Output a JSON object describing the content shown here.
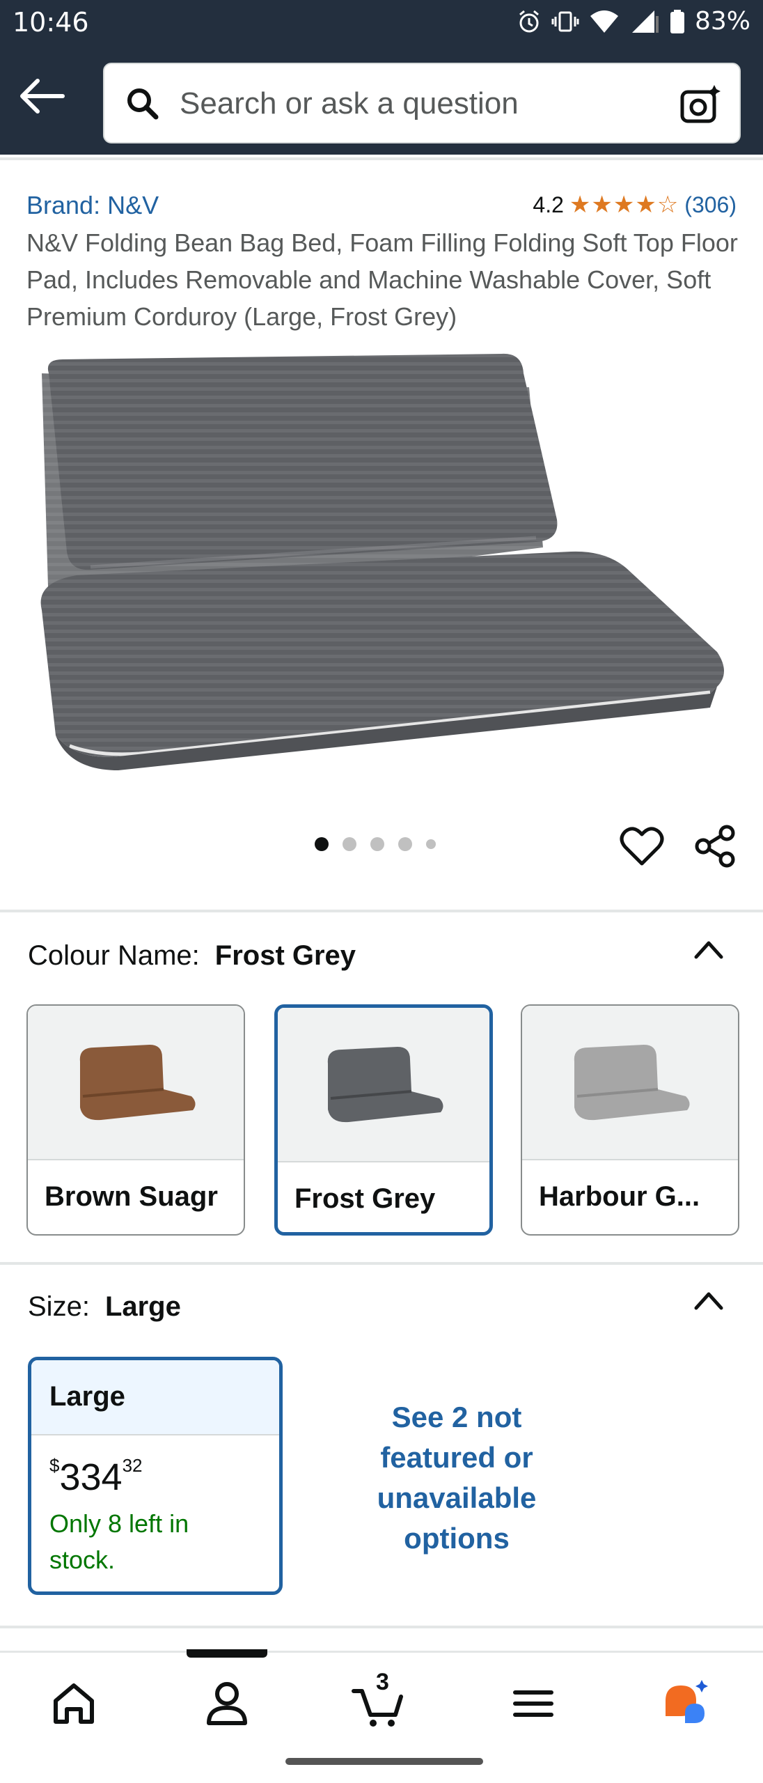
{
  "status_bar": {
    "time": "10:46",
    "battery": "83%",
    "icons": [
      "alarm-icon",
      "vibrate-icon",
      "wifi-icon",
      "signal-icon",
      "battery-icon"
    ]
  },
  "header": {
    "search_placeholder": "Search or ask a question",
    "icons": [
      "back-arrow-icon",
      "search-icon",
      "camera-icon"
    ]
  },
  "product": {
    "brand": "Brand: N&V",
    "rating_value": "4.2",
    "rating_stars": "★★★★☆",
    "rating_count": "(306)",
    "title": "N&V Folding Bean Bag Bed, Foam Filling Folding Soft Top Floor Pad, Includes Removable and Machine Washable Cover, Soft Premium Corduroy (Large, Frost Grey)",
    "image_dots": 5,
    "active_dot": 1
  },
  "colour": {
    "label": "Colour Name:",
    "selected": "Frost Grey",
    "options": [
      {
        "label": "Brown Suagr",
        "color": "#8a5a3a"
      },
      {
        "label": "Frost Grey",
        "color": "#5f6266"
      },
      {
        "label": "Harbour G...",
        "color": "#a6a6a6"
      }
    ]
  },
  "size": {
    "label": "Size:",
    "selected": "Large",
    "option": {
      "label": "Large",
      "price_symbol": "$",
      "price_whole": "334",
      "price_fraction": "32",
      "stock": "Only 8 left in stock."
    },
    "more_options": "See 2 not featured or unavailable options"
  },
  "bottom_nav": {
    "items": [
      "home-icon",
      "account-icon",
      "cart-icon",
      "menu-icon",
      "rufus-icon"
    ],
    "cart_count": "3"
  },
  "colors": {
    "header_bg": "#232f3e",
    "link": "#2162a1",
    "star": "#de7921",
    "stock": "#007600"
  }
}
